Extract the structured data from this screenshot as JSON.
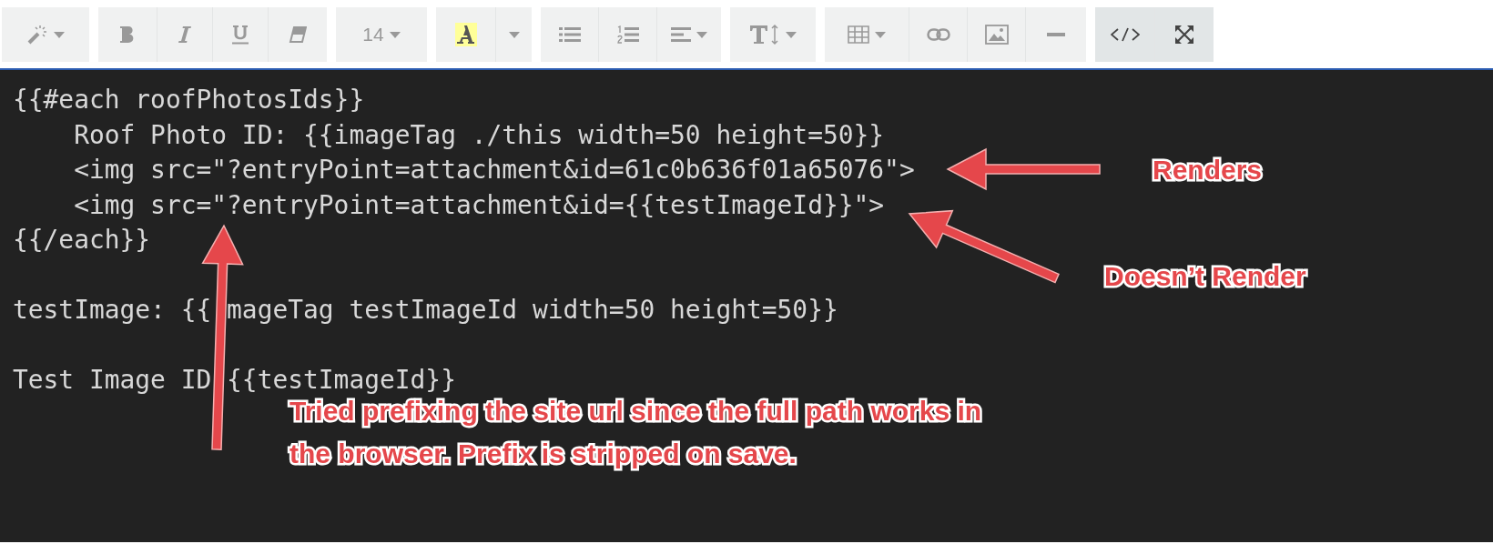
{
  "toolbar": {
    "groups": [
      {
        "buttons": [
          {
            "kind": "magic",
            "caret": true,
            "active": false
          }
        ]
      },
      {
        "buttons": [
          {
            "kind": "bold",
            "caret": false,
            "active": false
          },
          {
            "kind": "italic",
            "caret": false,
            "active": false
          },
          {
            "kind": "underline",
            "caret": false,
            "active": false
          },
          {
            "kind": "eraser",
            "caret": false,
            "active": false
          }
        ]
      },
      {
        "buttons": [
          {
            "kind": "text",
            "label": "14",
            "caret": true,
            "active": false
          }
        ]
      },
      {
        "buttons": [
          {
            "kind": "highlight",
            "caret": false,
            "active": false
          },
          {
            "kind": "caret",
            "caret": true,
            "active": false
          }
        ]
      },
      {
        "buttons": [
          {
            "kind": "bullets",
            "caret": false,
            "active": false
          },
          {
            "kind": "numbers",
            "caret": false,
            "active": false
          },
          {
            "kind": "align",
            "caret": true,
            "active": false
          }
        ]
      },
      {
        "buttons": [
          {
            "kind": "height",
            "caret": true,
            "active": false
          }
        ]
      },
      {
        "buttons": [
          {
            "kind": "table",
            "caret": true,
            "active": false
          },
          {
            "kind": "link",
            "caret": false,
            "active": false
          },
          {
            "kind": "image",
            "caret": false,
            "active": false
          },
          {
            "kind": "rule",
            "caret": false,
            "active": false
          }
        ]
      },
      {
        "buttons": [
          {
            "kind": "code",
            "caret": false,
            "active": true
          },
          {
            "kind": "fullscreen",
            "caret": false,
            "active": true
          }
        ]
      }
    ]
  },
  "editor": {
    "blocks": [
      [
        [
          "{{#each roofPhotosIds}}"
        ],
        [
          "    Roof Photo ID: {{imageTag ./this width=50 height=50}}"
        ],
        [
          "    <img src=\"?entryPoint=attachment&id=61c0b636f01a65076\">"
        ],
        [
          "    <img src=\"?entryPoint=attachment&id={{testImageId}}\">"
        ],
        [
          "{{/each}}"
        ]
      ],
      [
        [
          "testImage: {{",
          "mageTag testImageId width=50 height=50}}"
        ]
      ],
      [
        [
          "Test Image ID",
          "{{testImageId}}"
        ]
      ]
    ]
  },
  "annotations": [
    {
      "text": "Renders"
    },
    {
      "text": "Doesn’t Render"
    },
    {
      "text": "Tried prefixing the site url since the full path works in"
    },
    {
      "text": "the browser. Prefix is stripped on save."
    }
  ]
}
